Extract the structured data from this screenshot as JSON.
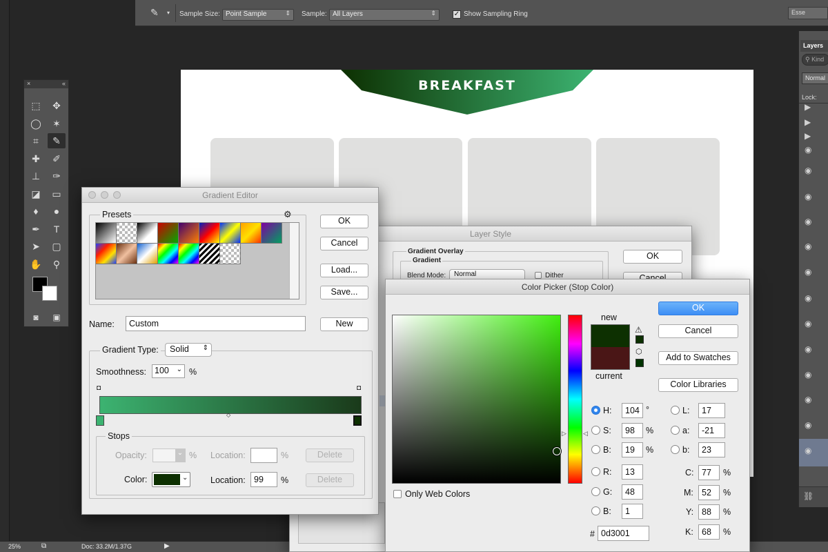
{
  "options_bar": {
    "sample_size_label": "Sample Size:",
    "sample_size_value": "Point Sample",
    "sample_label": "Sample:",
    "sample_value": "All Layers",
    "show_ring_label": "Show Sampling Ring",
    "show_ring_checked": true
  },
  "workspace": {
    "essentials_label": "Esse"
  },
  "canvas": {
    "banner_title": "BREAKFAST",
    "banner_colors": [
      "#0d3001",
      "#3cb371"
    ]
  },
  "layers_panel": {
    "title": "Layers",
    "kind_placeholder": "Kind",
    "blend_mode": "Normal",
    "lock_label": "Lock:"
  },
  "status_bar": {
    "zoom": "25%",
    "doc_info": "Doc: 33.2M/1.37G"
  },
  "gradient_editor": {
    "title": "Gradient Editor",
    "presets_label": "Presets",
    "buttons": {
      "ok": "OK",
      "cancel": "Cancel",
      "load": "Load...",
      "save": "Save...",
      "new": "New"
    },
    "name_label": "Name:",
    "name_value": "Custom",
    "gradient_type_label": "Gradient Type:",
    "gradient_type_value": "Solid",
    "smoothness_label": "Smoothness:",
    "smoothness_value": "100",
    "smoothness_unit": "%",
    "stops_label": "Stops",
    "opacity_label": "Opacity:",
    "opacity_unit": "%",
    "location_label": "Location:",
    "location_unit": "%",
    "delete_label": "Delete",
    "color_label": "Color:",
    "color_swatch": "#0d3001",
    "color_location_value": "99",
    "gradient_start_color": "#3cb371",
    "gradient_end_color": "#1a3a1a"
  },
  "layer_style": {
    "title": "Layer Style",
    "section_title": "Gradient Overlay",
    "subsection_title": "Gradient",
    "blend_mode_label": "Blend Mode:",
    "blend_mode_value": "Normal",
    "dither_label": "Dither",
    "ok_label": "OK",
    "cancel_label": "Cancel"
  },
  "color_picker": {
    "title": "Color Picker (Stop Color)",
    "new_label": "new",
    "current_label": "current",
    "new_color": "#0d3001",
    "current_color": "#4a1616",
    "buttons": {
      "ok": "OK",
      "cancel": "Cancel",
      "add_to_swatches": "Add to Swatches",
      "color_libraries": "Color Libraries"
    },
    "only_web_colors_label": "Only Web Colors",
    "hsb": {
      "h_label": "H:",
      "h": "104",
      "h_unit": "°",
      "s_label": "S:",
      "s": "98",
      "s_unit": "%",
      "b_label": "B:",
      "b": "19",
      "b_unit": "%"
    },
    "rgb": {
      "r_label": "R:",
      "r": "13",
      "g_label": "G:",
      "g": "48",
      "b_label": "B:",
      "b": "1"
    },
    "lab": {
      "l_label": "L:",
      "l": "17",
      "a_label": "a:",
      "a": "-21",
      "b_label": "b:",
      "b": "23"
    },
    "cmyk": {
      "c_label": "C:",
      "c": "77",
      "m_label": "M:",
      "m": "52",
      "y_label": "Y:",
      "y": "88",
      "k_label": "K:",
      "k": "68",
      "unit": "%"
    },
    "hex_label": "#",
    "hex": "0d3001",
    "field_hue_color": "#40ee10"
  }
}
